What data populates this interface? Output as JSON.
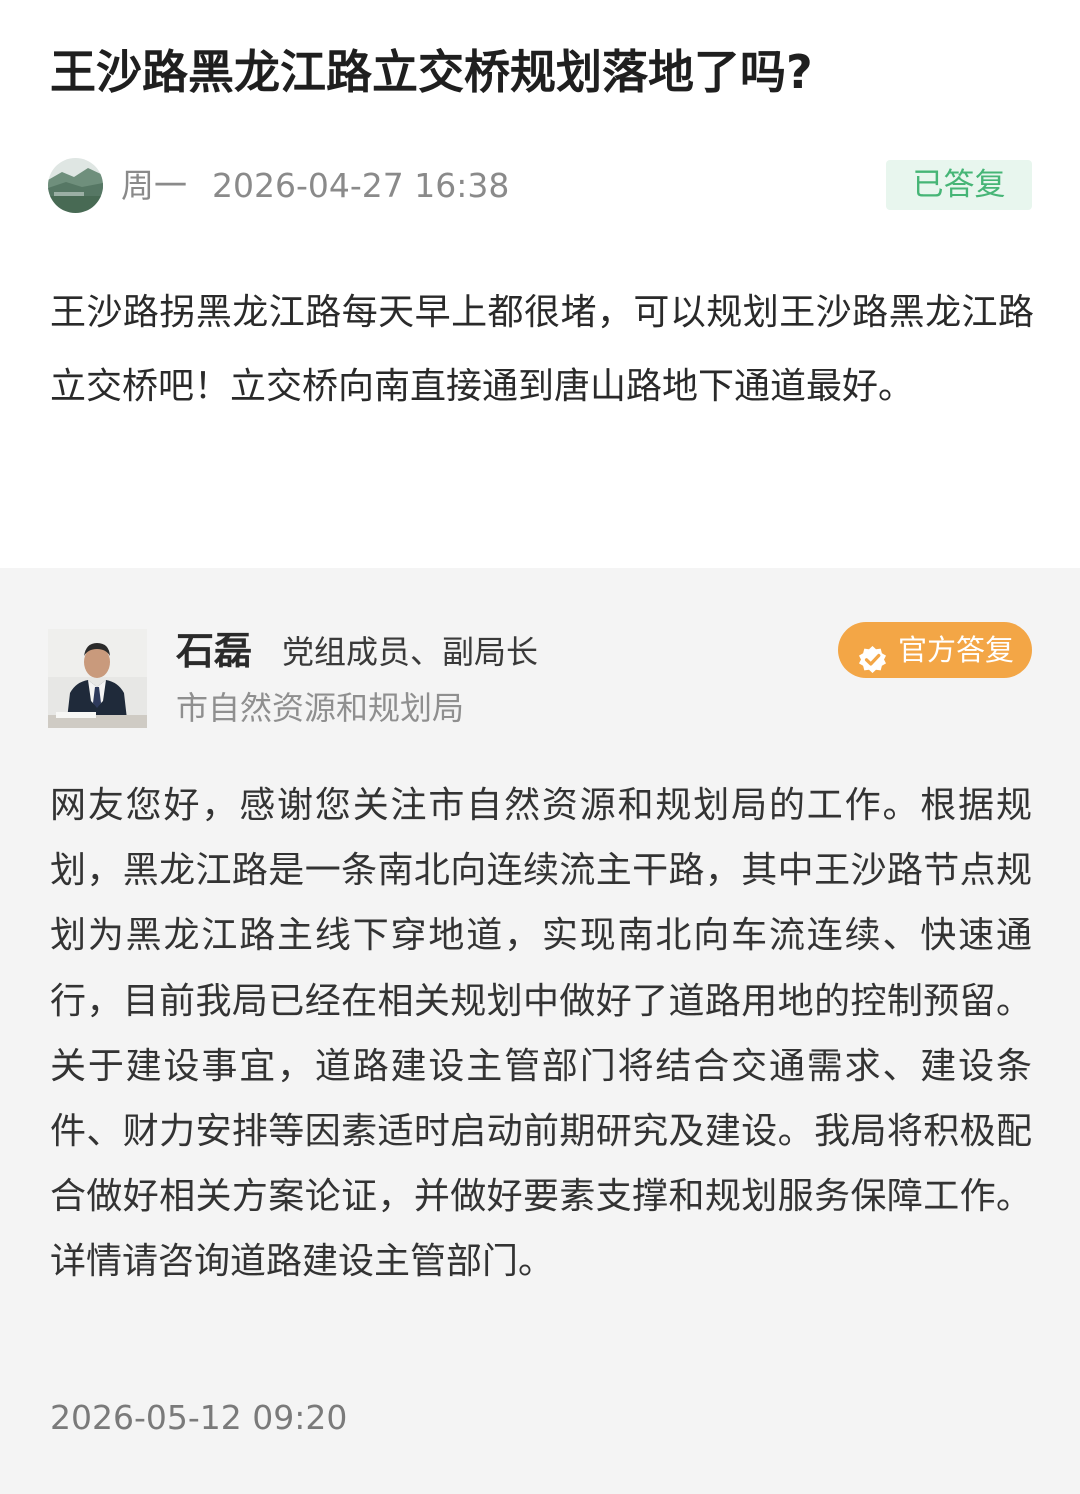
{
  "question": {
    "title": "王沙路黑龙江路立交桥规划落地了吗?",
    "asker_name": "周一",
    "asked_at": "2026-04-27 16:38",
    "status": "已答复",
    "body": "王沙路拐黑龙江路每天早上都很堵，可以规划王沙路黑龙江路立交桥吧！立交桥向南直接通到唐山路地下通道最好。"
  },
  "answer": {
    "official_name": "石磊",
    "official_title": "党组成员、副局长",
    "department": "市自然资源和规划局",
    "badge_label": "官方答复",
    "body": "网友您好，感谢您关注市自然资源和规划局的工作。根据规划，黑龙江路是一条南北向连续流主干路，其中王沙路节点规划为黑龙江路主线下穿地道，实现南北向车流连续、快速通行，目前我局已经在相关规划中做好了道路用地的控制预留。关于建设事宜，道路建设主管部门将结合交通需求、建设条件、财力安排等因素适时启动前期研究及建设。我局将积极配合做好相关方案论证，并做好要素支撑和规划服务保障工作。详情请咨询道路建设主管部门。",
    "replied_at": "2026-05-12 09:20"
  },
  "icons": {
    "asker_avatar": "landscape-avatar-icon",
    "official_photo": "official-portrait-photo",
    "badge_icon": "verified-check-icon"
  },
  "colors": {
    "status_green": "#46b576",
    "status_bg": "#e8f6ee",
    "badge_orange": "#f3a646",
    "answer_bg": "#f4f4f4"
  }
}
